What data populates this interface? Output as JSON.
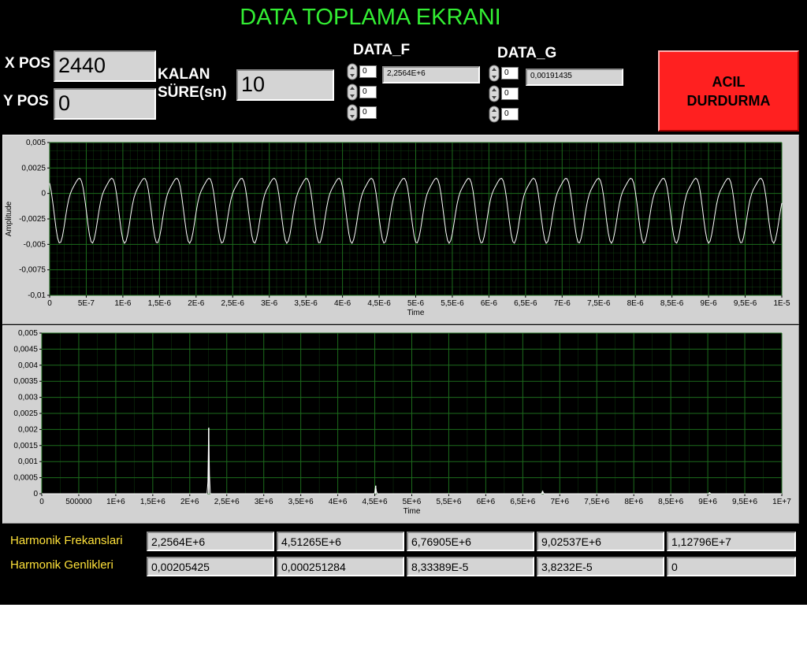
{
  "title": "DATA TOPLAMA EKRANI",
  "xpos": {
    "label": "X POS",
    "value": "2440"
  },
  "ypos": {
    "label": "Y POS",
    "value": "0"
  },
  "kalan": {
    "label_line1": "KALAN",
    "label_line2": "SÜRE(sn)",
    "value": "10"
  },
  "data_f": {
    "label": "DATA_F",
    "indices": [
      "0",
      "0",
      "0"
    ],
    "value": "2,2564E+6"
  },
  "data_g": {
    "label": "DATA_G",
    "indices": [
      "0",
      "0",
      "0"
    ],
    "value": "0,00191435"
  },
  "stop_button": {
    "line1": "ACIL",
    "line2": "DURDURMA",
    "color": "#ff2020"
  },
  "colors": {
    "plot_background": "#000000",
    "grid": "#1c6b1c",
    "trace": "#ffffff",
    "title": "#33ee33",
    "harmonic_labels": "#ffe23a"
  },
  "chart_data": [
    {
      "type": "line",
      "xlabel": "Time",
      "ylabel": "Amplitude",
      "xlim": [
        0,
        1e-05
      ],
      "ylim": [
        -0.01,
        0.005
      ],
      "grid": true,
      "x_ticks": [
        "0",
        "5E-7",
        "1E-6",
        "1,5E-6",
        "2E-6",
        "2,5E-6",
        "3E-6",
        "3,5E-6",
        "4E-6",
        "4,5E-6",
        "5E-6",
        "5,5E-6",
        "6E-6",
        "6,5E-6",
        "7E-6",
        "7,5E-6",
        "8E-6",
        "8,5E-6",
        "9E-6",
        "9,5E-6",
        "1E-5"
      ],
      "y_ticks": [
        "0,005",
        "0,0025",
        "0",
        "-0,0025",
        "-0,005",
        "-0,0075",
        "-0,01"
      ],
      "series": [
        {
          "frequency_hz": 2256400,
          "amplitude": 0.0033,
          "offset": -0.0012
        }
      ]
    },
    {
      "type": "line",
      "xlabel": "Time",
      "ylabel": "",
      "xlim": [
        0,
        10000000
      ],
      "ylim": [
        0,
        0.005
      ],
      "grid": true,
      "x_ticks": [
        "0",
        "500000",
        "1E+6",
        "1,5E+6",
        "2E+6",
        "2,5E+6",
        "3E+6",
        "3,5E+6",
        "4E+6",
        "4,5E+6",
        "5E+6",
        "5,5E+6",
        "6E+6",
        "6,5E+6",
        "7E+6",
        "7,5E+6",
        "8E+6",
        "8,5E+6",
        "9E+6",
        "9,5E+6",
        "1E+7"
      ],
      "y_ticks": [
        "0,005",
        "0,0045",
        "0,004",
        "0,0035",
        "0,003",
        "0,0025",
        "0,002",
        "0,0015",
        "0,001",
        "0,0005",
        "0"
      ],
      "peaks": [
        {
          "x": 2256400,
          "y": 0.00205425
        },
        {
          "x": 4512650,
          "y": 0.000251284
        },
        {
          "x": 6769050,
          "y": 8.33389e-05
        },
        {
          "x": 9025370,
          "y": 3.8232e-05
        }
      ]
    }
  ],
  "harmonics": {
    "freq_label": "Harmonik Frekanslari",
    "amp_label": "Harmonik Genlikleri",
    "frequencies": [
      "2,2564E+6",
      "4,51265E+6",
      "6,76905E+6",
      "9,02537E+6",
      "1,12796E+7"
    ],
    "amplitudes": [
      "0,00205425",
      "0,000251284",
      "8,33389E-5",
      "3,8232E-5",
      "0"
    ]
  }
}
